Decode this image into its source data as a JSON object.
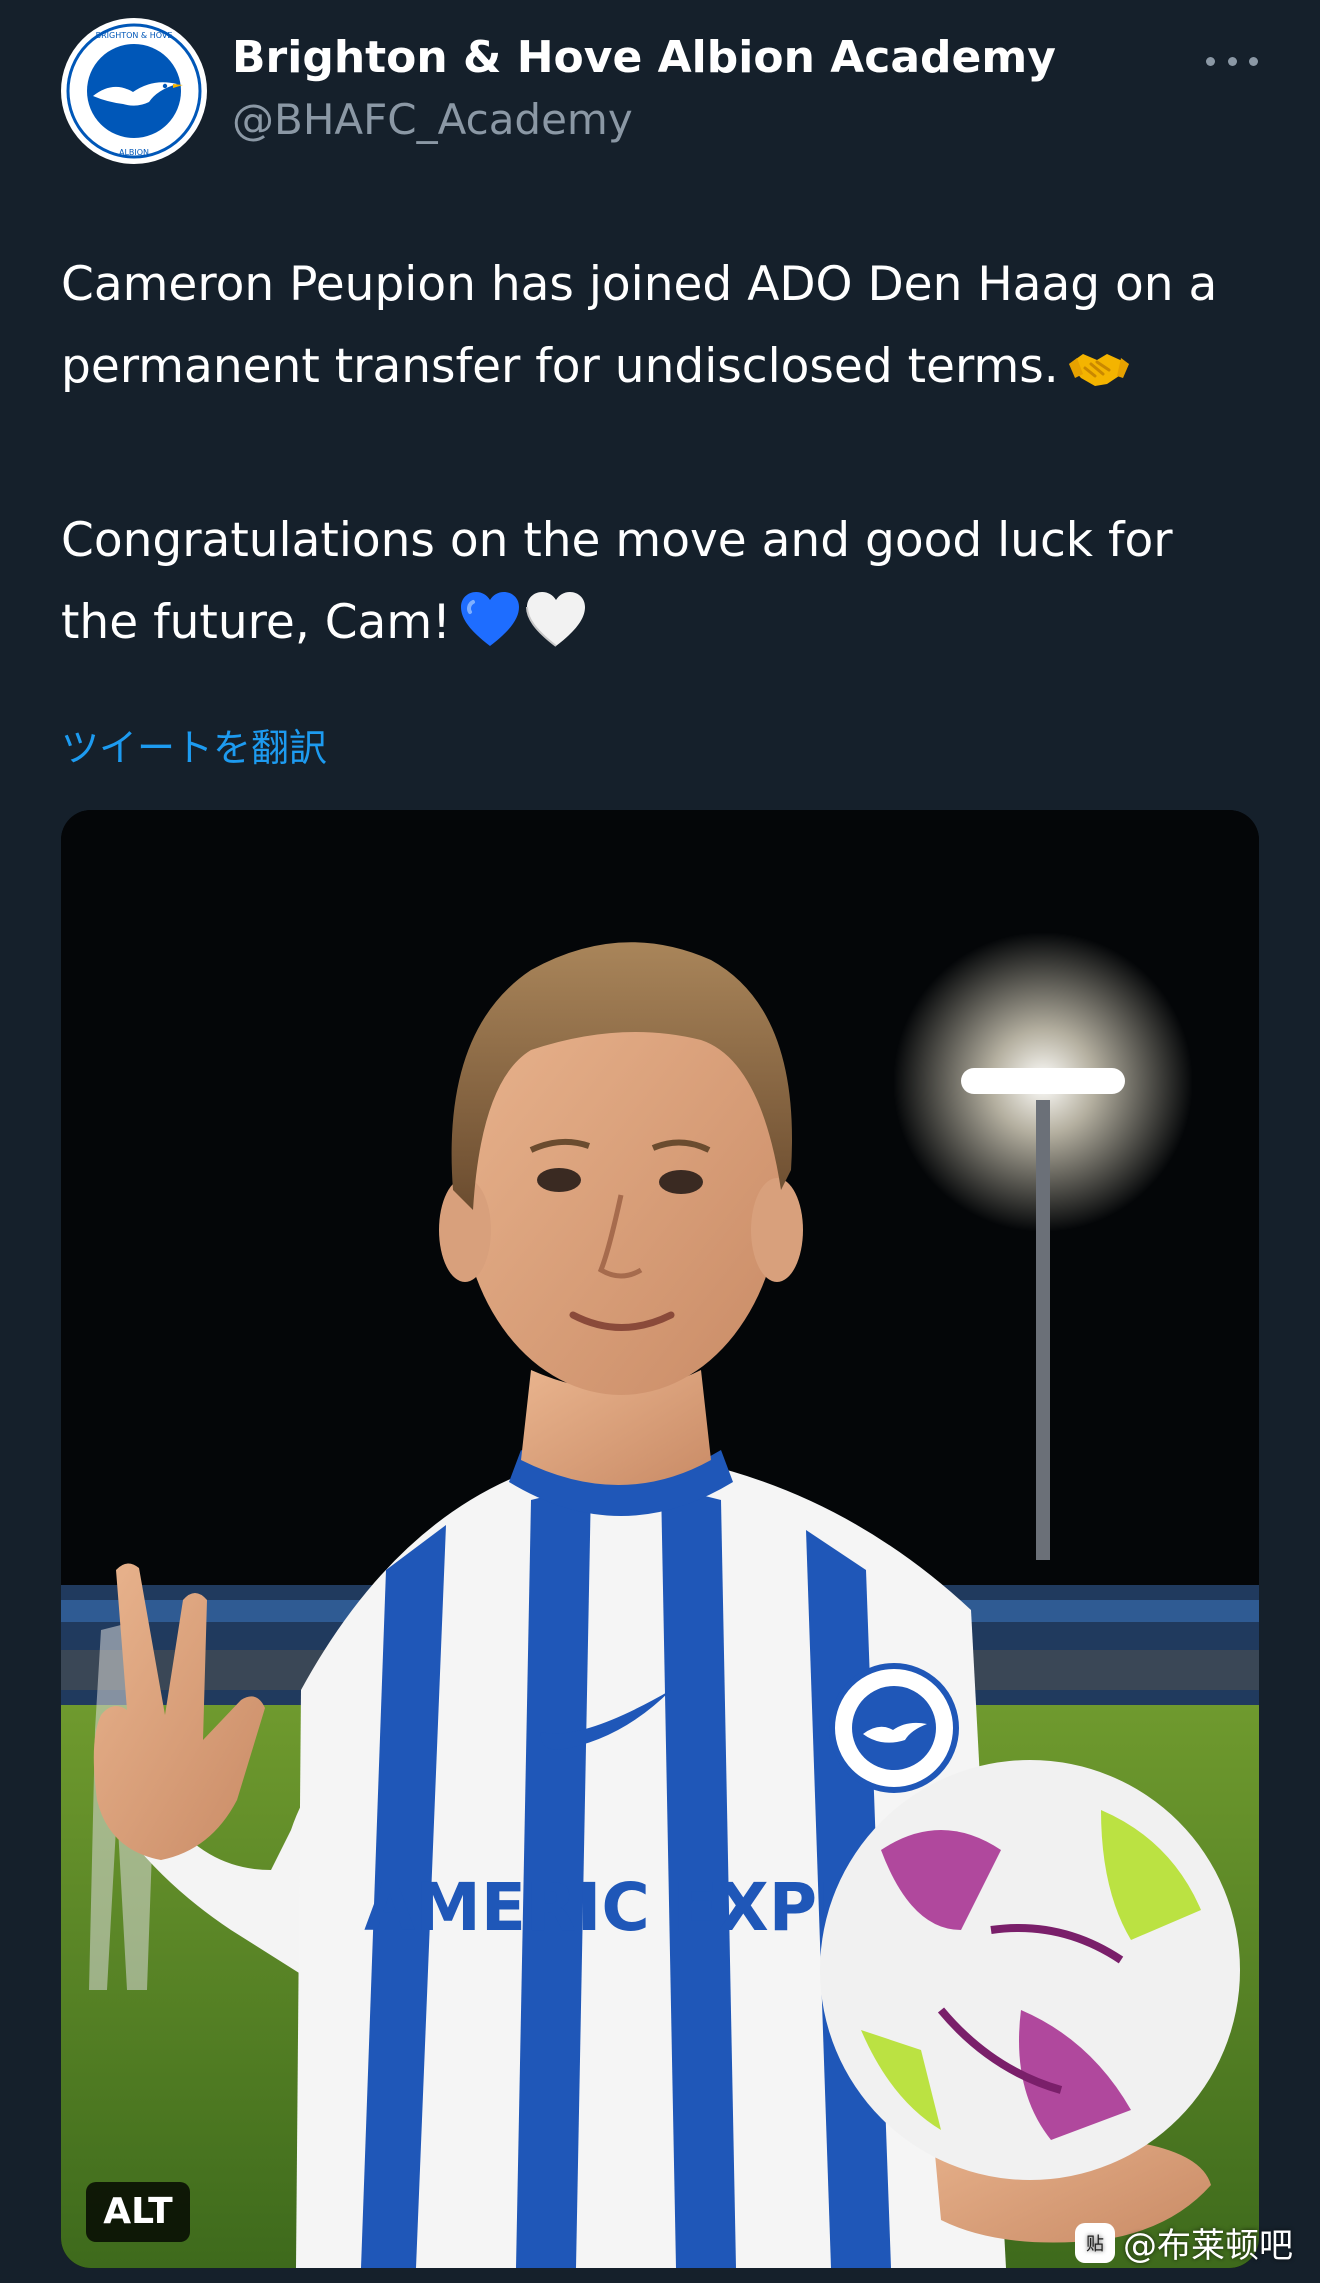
{
  "tweet": {
    "author": {
      "display_name": "Brighton & Hove Albion Academy",
      "handle": "@BHAFC_Academy",
      "avatar_logo_text": "BRIGHTON & HOVE ALBION"
    },
    "text_paragraph_1": "Cameron Peupion has joined ADO Den Haag on a permanent transfer for undisclosed terms.",
    "text_paragraph_2": "Congratulations on the move and good luck for the future, Cam!",
    "emojis": [
      "handshake-emoji",
      "blue-heart-emoji",
      "white-heart-emoji"
    ],
    "translate_label": "ツイートを翻訳",
    "more_icon": "more-dots-icon",
    "media": {
      "alt_label": "ALT",
      "shirt_sponsor_text": "AMERIC EXPR"
    }
  },
  "watermark": {
    "text": "@布莱顿吧",
    "icon_glyph": "贴"
  },
  "colors": {
    "background": "#15202b",
    "text_primary": "#ffffff",
    "text_secondary": "#8b98a5",
    "link": "#1d9bf0",
    "club_blue": "#0057b8"
  }
}
